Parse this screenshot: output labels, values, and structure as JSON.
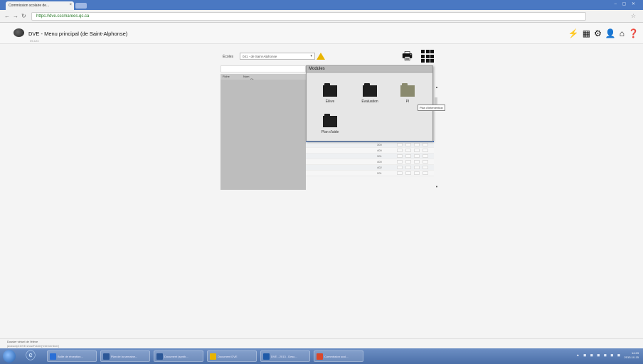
{
  "browser": {
    "tab_title": "Commission scolaire de...",
    "tab_close": "×",
    "url": "https://dve.cssmarees.qc.ca",
    "window_controls": "–  ▢  ✕"
  },
  "app": {
    "title": "DVE - Menu principal (de Saint-Alphonse)",
    "subtitle": "09-123",
    "header_icons": [
      "bolt-icon",
      "grid-icon",
      "gear-icon",
      "user-icon",
      "home-icon",
      "help-icon"
    ]
  },
  "controls": {
    "ecoles_label": "Écoles",
    "ecoles_value": "041 - de Saint-Alphonse",
    "warning_icon": "warning-icon",
    "print_icon": "print-icon",
    "grid_icon": "grid-menu-icon"
  },
  "table": {
    "headers": [
      "Fiche",
      "Nom",
      "Gr"
    ],
    "rows": [
      {
        "num": "300"
      },
      {
        "num": "400"
      },
      {
        "num": "301"
      },
      {
        "num": "400"
      },
      {
        "num": "402"
      },
      {
        "num": "201"
      }
    ]
  },
  "modules": {
    "title": "Modules",
    "items": [
      {
        "label": "Élève",
        "color": "#1f1f1f"
      },
      {
        "label": "Évaluation",
        "color": "#1f1f1f"
      },
      {
        "label": "PI",
        "color": "#8a8a6e"
      },
      {
        "label": "Plan d'aide",
        "color": "#1f1f1f"
      }
    ],
    "tooltip": "Plan d'intervention"
  },
  "statusbar": {
    "line1": "Dossier virtuel de l'élève",
    "line2": "javascript:DVE.showFolder('Intervention')"
  },
  "taskbar": {
    "buttons": [
      {
        "label": "Boîte de réception...",
        "color": "#2a6fd6"
      },
      {
        "label": "Plan de la semaine...",
        "color": "#2b5797"
      },
      {
        "label": "Document (synth...",
        "color": "#2b5797"
      },
      {
        "label": "Document DVE",
        "color": "#e8b400"
      },
      {
        "label": "DVE - 2013 - Desc...",
        "color": "#1f5aa8"
      },
      {
        "label": "Commission scol...",
        "color": "#d9472b"
      }
    ],
    "time": "14:23",
    "date": "2013-10-15"
  }
}
